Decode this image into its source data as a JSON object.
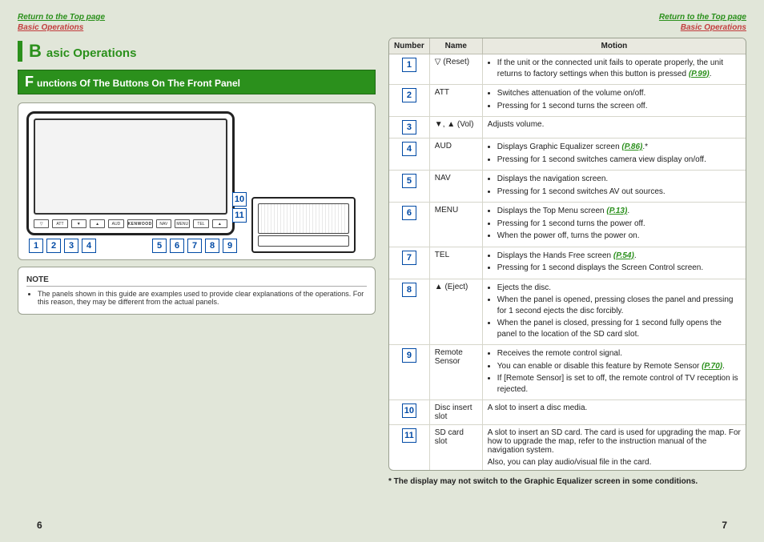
{
  "top_links": {
    "return": "Return to the Top page",
    "basic_ops": "Basic Operations"
  },
  "section_title": {
    "big": "B",
    "rest": "asic Operations"
  },
  "subsection_title": {
    "big": "F",
    "rest": "unctions Of The Buttons On The Front Panel"
  },
  "front_buttons": [
    "▽",
    "ATT",
    "▼",
    "▲",
    "AUD",
    "KENWOOD",
    "NAV",
    "MENU",
    "TEL",
    "▲"
  ],
  "left_callouts": [
    "1",
    "2",
    "3",
    "4"
  ],
  "right_callouts": [
    "5",
    "6",
    "7",
    "8",
    "9"
  ],
  "side_callouts": [
    "10",
    "11"
  ],
  "note": {
    "title": "NOTE",
    "items": [
      "The panels shown in this guide are examples used to provide clear explanations of the operations. For this reason, they may be different from the actual panels."
    ]
  },
  "table": {
    "headers": {
      "number": "Number",
      "name": "Name",
      "motion": "Motion"
    },
    "rows": [
      {
        "num": "1",
        "name": "▽ (Reset)",
        "motion": [
          {
            "text": "If the unit or the connected unit fails to operate properly, the unit returns to factory settings when this button is pressed ",
            "ref": "(P.99)",
            "tail": "."
          }
        ]
      },
      {
        "num": "2",
        "name": "ATT",
        "motion": [
          {
            "text": "Switches attenuation of the volume on/off."
          },
          {
            "text": "Pressing for 1 second turns the screen off."
          }
        ]
      },
      {
        "num": "3",
        "name": "▼, ▲ (Vol)",
        "motion_plain": "Adjusts volume."
      },
      {
        "num": "4",
        "name": "AUD",
        "motion": [
          {
            "text": "Displays Graphic Equalizer screen ",
            "ref": "(P.86)",
            "tail": ".*"
          },
          {
            "text": "Pressing for 1 second switches camera view display on/off."
          }
        ]
      },
      {
        "num": "5",
        "name": "NAV",
        "motion": [
          {
            "text": "Displays the navigation screen."
          },
          {
            "text": "Pressing for 1 second switches AV out sources."
          }
        ]
      },
      {
        "num": "6",
        "name": "MENU",
        "motion": [
          {
            "text": "Displays the Top Menu screen ",
            "ref": "(P.13)",
            "tail": "."
          },
          {
            "text": "Pressing for 1 second turns the power off."
          },
          {
            "text": "When the power off, turns the power on."
          }
        ]
      },
      {
        "num": "7",
        "name": "TEL",
        "motion": [
          {
            "text": "Displays the Hands Free screen ",
            "ref": "(P.54)",
            "tail": "."
          },
          {
            "text": "Pressing for 1 second displays the Screen Control screen."
          }
        ]
      },
      {
        "num": "8",
        "name": "▲ (Eject)",
        "motion": [
          {
            "text": "Ejects the disc."
          },
          {
            "text": "When the panel is opened, pressing closes the panel and pressing for 1 second ejects the disc forcibly."
          },
          {
            "text": "When the panel is closed, pressing for 1 second fully opens the panel to the location of the SD card slot."
          }
        ]
      },
      {
        "num": "9",
        "name": "Remote Sensor",
        "motion": [
          {
            "text": "Receives the remote control signal."
          },
          {
            "text": "You can enable or disable this feature by Remote Sensor ",
            "ref": "(P.70)",
            "tail": "."
          },
          {
            "text": "If [Remote Sensor] is set to off, the remote control of TV reception is rejected."
          }
        ]
      },
      {
        "num": "10",
        "name": "Disc insert slot",
        "motion_plain": "A slot to insert a disc media."
      },
      {
        "num": "11",
        "name": "SD card slot",
        "motion_multi": [
          "A slot to insert an SD card. The card is used for upgrading the map. For how to upgrade the map, refer to the instruction manual of the navigation system.",
          "Also, you can play audio/visual file in the card."
        ]
      }
    ]
  },
  "footnote": "* The display may not switch to the Graphic Equalizer screen in some conditions.",
  "page_numbers": {
    "left": "6",
    "right": "7"
  }
}
